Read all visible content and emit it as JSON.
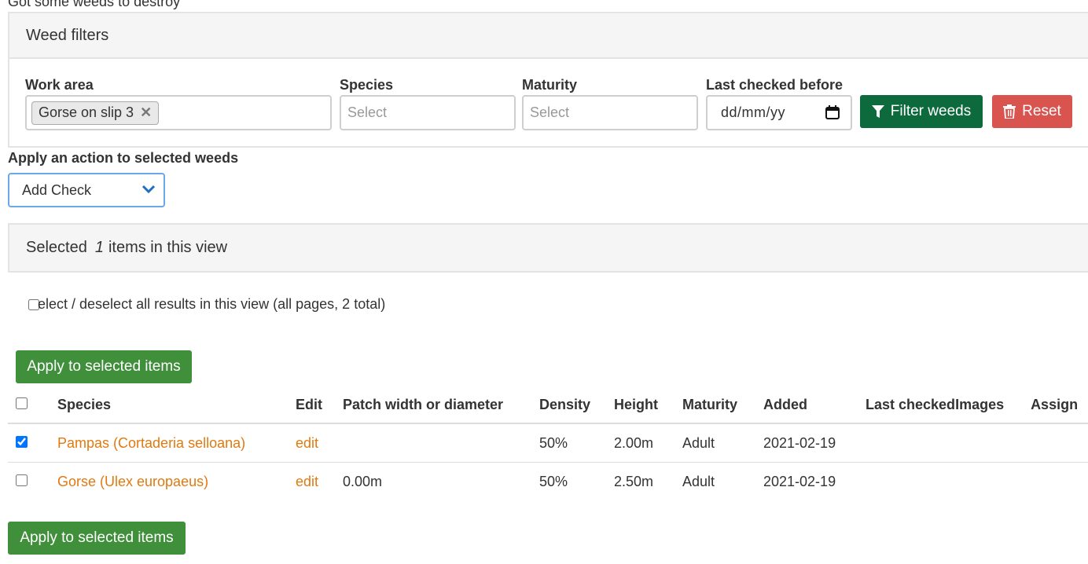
{
  "page": {
    "top_text": "Got some weeds to destroy"
  },
  "filters": {
    "title": "Weed filters",
    "work_area": {
      "label": "Work area",
      "chip": "Gorse on slip 3"
    },
    "species": {
      "label": "Species",
      "placeholder": "Select"
    },
    "maturity": {
      "label": "Maturity",
      "placeholder": "Select"
    },
    "last_checked": {
      "label": "Last checked before",
      "placeholder": "dd/mm/yy"
    },
    "filter_button": "Filter weeds",
    "reset_button": "Reset"
  },
  "action": {
    "label": "Apply an action to selected weeds",
    "selected": "Add Check"
  },
  "selection": {
    "prefix": "Selected",
    "count": "1",
    "suffix": "items in this view",
    "select_all_text": "elect / deselect all results in this view (all pages, 2 total)"
  },
  "apply_button": "Apply to selected items",
  "table": {
    "headers": [
      "Species",
      "Edit",
      "Patch width or diameter",
      "Density",
      "Height",
      "Maturity",
      "Added",
      "Last checked",
      "Images",
      "Assign"
    ],
    "rows": [
      {
        "checked": true,
        "species": "Pampas (Cortaderia selloana)",
        "edit": "edit",
        "patch": "",
        "density": "50%",
        "height": "2.00m",
        "maturity": "Adult",
        "added": "2021-02-19",
        "last_checked": "",
        "images": "",
        "assigned": ""
      },
      {
        "checked": false,
        "species": "Gorse (Ulex europaeus)",
        "edit": "edit",
        "patch": "0.00m",
        "density": "50%",
        "height": "2.50m",
        "maturity": "Adult",
        "added": "2021-02-19",
        "last_checked": "",
        "images": "",
        "assigned": ""
      }
    ]
  },
  "colors": {
    "filter": "#0d6a3d",
    "reset": "#d9534f",
    "apply": "#3f8f3b",
    "link": "#e07a10",
    "focus": "#6aa9e9"
  }
}
